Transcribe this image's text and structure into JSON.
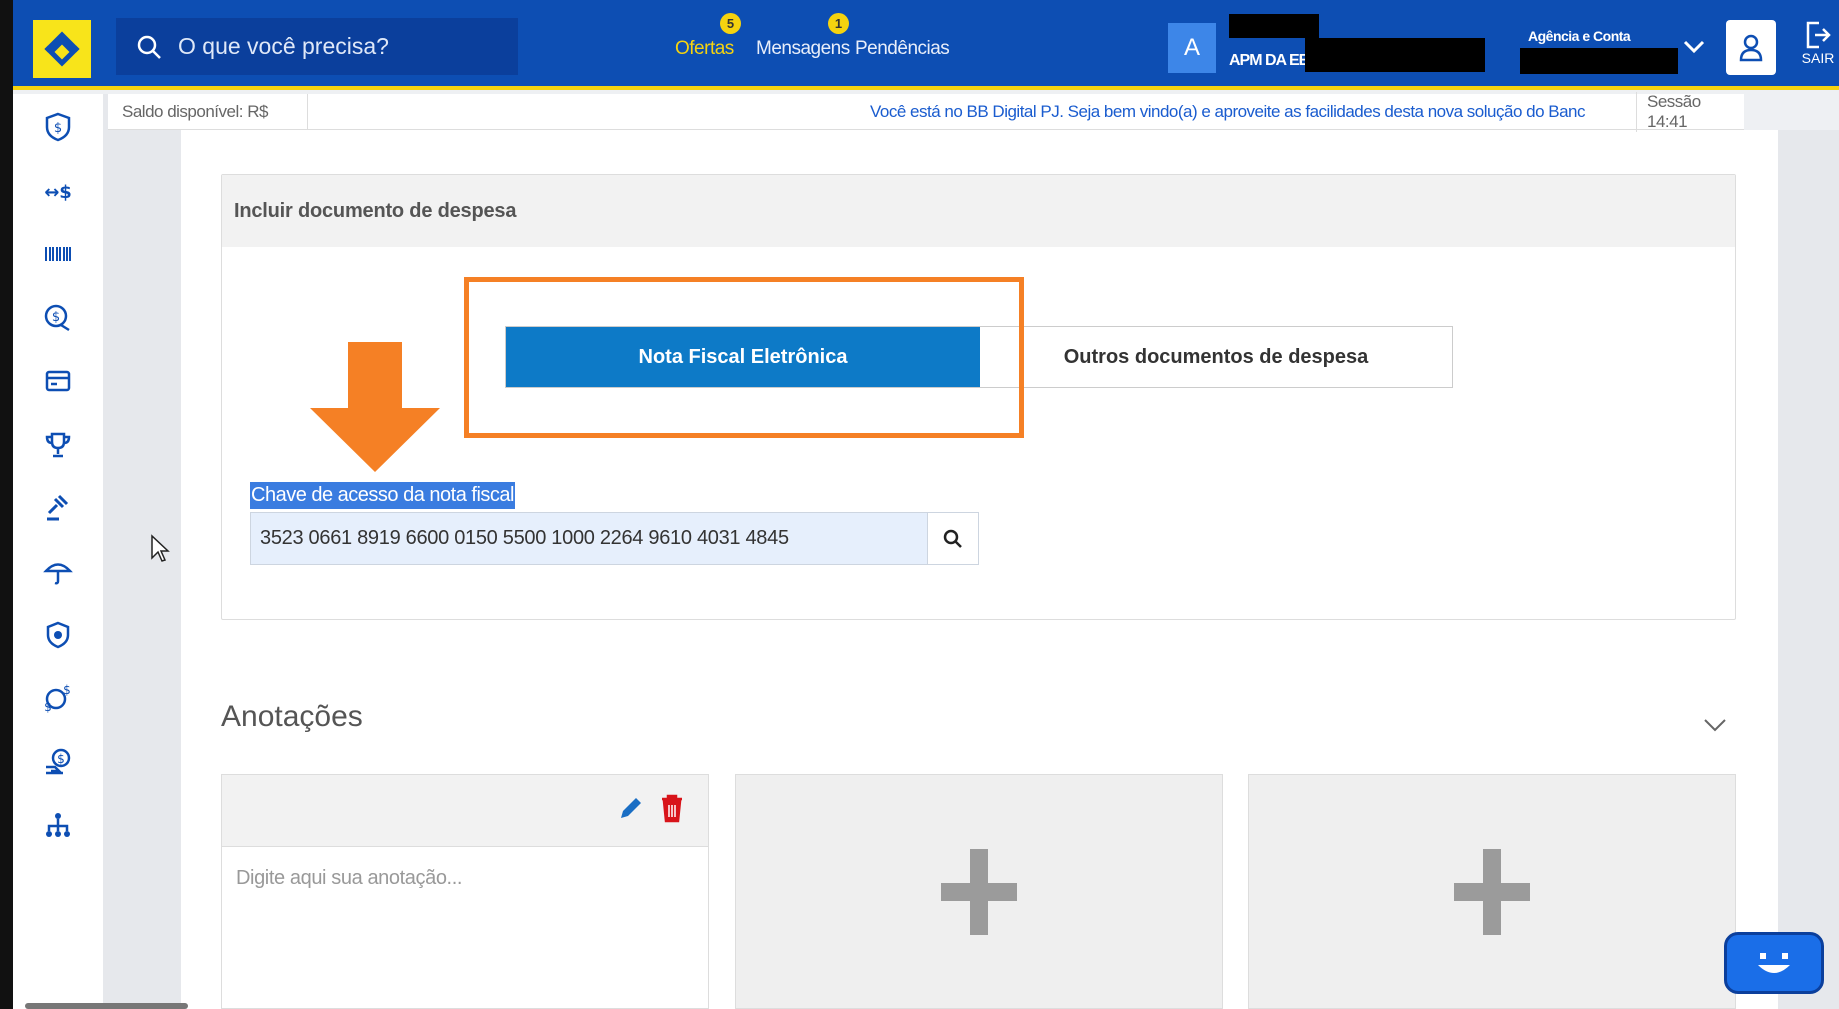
{
  "header": {
    "search_placeholder": "O que você precisa?",
    "nav": [
      {
        "label": "Ofertas",
        "badge": "5"
      },
      {
        "label": "Mensagens",
        "badge": "1"
      },
      {
        "label": "Pendências",
        "badge": ""
      }
    ],
    "user_initial": "A",
    "user_line2": "APM DA EE",
    "agency_label": "Agência e Conta",
    "logout_label": "SAIR"
  },
  "infobar": {
    "saldo": "Saldo disponível: R$",
    "welcome": "Você está no BB Digital PJ. Seja bem vindo(a) e aproveite as facilidades desta nova solução do Banc",
    "sessao": "Sessão 14:41"
  },
  "card": {
    "title": "Incluir documento de despesa",
    "tabs": [
      {
        "label": "Nota Fiscal Eletrônica",
        "active": true
      },
      {
        "label": "Outros documentos de despesa",
        "active": false
      }
    ],
    "field_label": "Chave de acesso da nota fiscal",
    "field_value": "3523 0661 8919 6600 0150 5500 1000 2264 9610 4031 4845"
  },
  "notes": {
    "title": "Anotações",
    "placeholder": "Digite aqui sua anotação..."
  },
  "colors": {
    "header_blue": "#0d4eb3",
    "brand_yellow": "#f5d30f",
    "tab_active": "#0d7ac7",
    "annotation_orange": "#f58025"
  }
}
